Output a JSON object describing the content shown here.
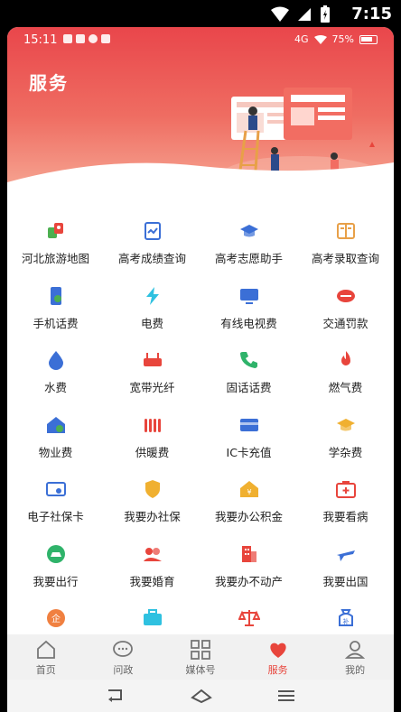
{
  "phone_status": {
    "time": "7:15"
  },
  "inner_status": {
    "time": "15:11",
    "battery": "75%",
    "network": "4G"
  },
  "header": {
    "title": "服务"
  },
  "services": [
    [
      {
        "label": "河北旅游地图",
        "icon": "map-icon",
        "color": "#e8453c"
      },
      {
        "label": "高考成绩查询",
        "icon": "score-report-icon",
        "color": "#3b6fd6"
      },
      {
        "label": "高考志愿助手",
        "icon": "graduation-cap-icon",
        "color": "#3b6fd6"
      },
      {
        "label": "高考录取查询",
        "icon": "admission-book-icon",
        "color": "#e8a048"
      }
    ],
    [
      {
        "label": "手机话费",
        "icon": "phone-bill-icon",
        "color": "#3b6fd6"
      },
      {
        "label": "电费",
        "icon": "lightning-icon",
        "color": "#2fc1e0"
      },
      {
        "label": "有线电视费",
        "icon": "tv-icon",
        "color": "#3b6fd6"
      },
      {
        "label": "交通罚款",
        "icon": "traffic-icon",
        "color": "#e8453c"
      }
    ],
    [
      {
        "label": "水费",
        "icon": "water-drop-icon",
        "color": "#3b6fd6"
      },
      {
        "label": "宽带光纤",
        "icon": "router-icon",
        "color": "#e8453c"
      },
      {
        "label": "固话话费",
        "icon": "telephone-icon",
        "color": "#2fb36a"
      },
      {
        "label": "燃气费",
        "icon": "flame-icon",
        "color": "#e8453c"
      }
    ],
    [
      {
        "label": "物业费",
        "icon": "house-icon",
        "color": "#3b6fd6"
      },
      {
        "label": "供暖费",
        "icon": "radiator-icon",
        "color": "#e8453c"
      },
      {
        "label": "IC卡充值",
        "icon": "card-icon",
        "color": "#3b6fd6"
      },
      {
        "label": "学杂费",
        "icon": "graduation-cap-icon",
        "color": "#f0b030"
      }
    ],
    [
      {
        "label": "电子社保卡",
        "icon": "social-card-icon",
        "color": "#3b6fd6"
      },
      {
        "label": "我要办社保",
        "icon": "shield-icon",
        "color": "#f0b030"
      },
      {
        "label": "我要办公积金",
        "icon": "fund-house-icon",
        "color": "#f0b030"
      },
      {
        "label": "我要看病",
        "icon": "medical-kit-icon",
        "color": "#e8453c"
      }
    ],
    [
      {
        "label": "我要出行",
        "icon": "travel-icon",
        "color": "#2fb36a"
      },
      {
        "label": "我要婚育",
        "icon": "couple-icon",
        "color": "#e8453c"
      },
      {
        "label": "我要办不动产",
        "icon": "building-icon",
        "color": "#e8453c"
      },
      {
        "label": "我要出国",
        "icon": "airplane-icon",
        "color": "#3b6fd6"
      }
    ],
    [
      {
        "label": "",
        "icon": "enterprise-icon",
        "color": "#f08040"
      },
      {
        "label": "",
        "icon": "briefcase-icon",
        "color": "#2fc1e0"
      },
      {
        "label": "",
        "icon": "scales-icon",
        "color": "#e8453c"
      },
      {
        "label": "",
        "icon": "subsidy-bag-icon",
        "color": "#3b6fd6"
      }
    ]
  ],
  "bottom_nav": [
    {
      "label": "首页",
      "icon": "home-icon"
    },
    {
      "label": "问政",
      "icon": "chat-bubble-icon"
    },
    {
      "label": "媒体号",
      "icon": "grid-icon"
    },
    {
      "label": "服务",
      "icon": "heart-icon",
      "active": true
    },
    {
      "label": "我的",
      "icon": "user-icon"
    }
  ],
  "accent_color": "#e8453c"
}
